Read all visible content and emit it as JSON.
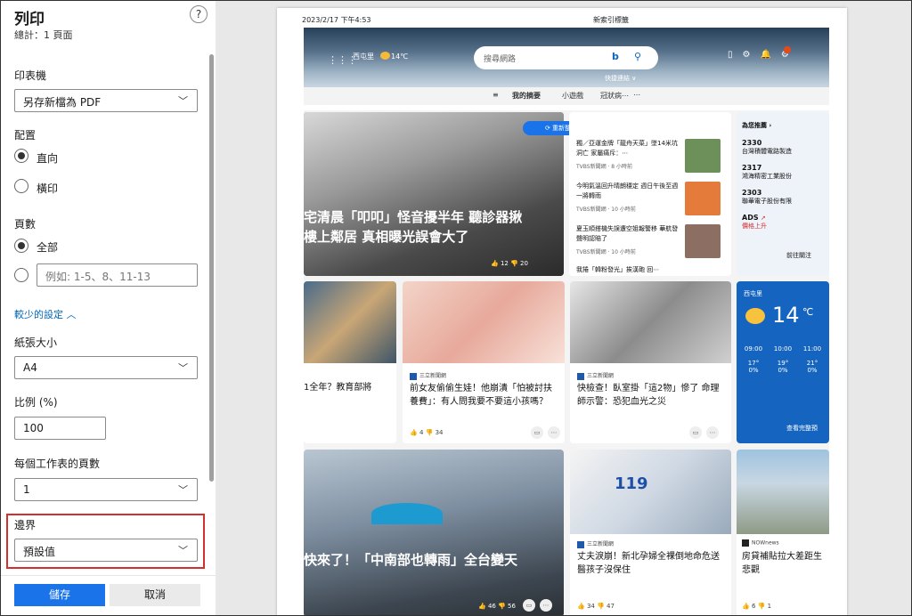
{
  "panel": {
    "title": "列印",
    "subtitle": "總計：1 頁面",
    "help": "?",
    "printer_label": "印表機",
    "printer_value": "另存新檔為 PDF",
    "layout_label": "配置",
    "layout_options": [
      "直向",
      "橫印"
    ],
    "pages_label": "頁數",
    "pages_all": "全部",
    "pages_placeholder": "例如: 1-5、8、11-13",
    "fewer_settings": "較少的設定",
    "paper_label": "紙張大小",
    "paper_value": "A4",
    "scale_label": "比例 (%)",
    "scale_value": "100",
    "pps_label": "每個工作表的頁數",
    "pps_value": "1",
    "margins_label": "邊界",
    "margins_value": "預設值",
    "save": "儲存",
    "cancel": "取消"
  },
  "preview": {
    "date": "2023/2/17 下午4:53",
    "tab_title": "新索引標籤",
    "location": "西屯里",
    "temp": "14℃",
    "search_placeholder": "搜尋網路",
    "hero_sub": "快捷連結 ∨",
    "nav": [
      "我的摘要",
      "小遊戲",
      "冠狀病⋯",
      "⋯"
    ],
    "refresh": "重新整理故事",
    "headline": [
      "宅清晨「叩叩」怪音擾半年 聽診器揪",
      "樓上鄰居 真相曝光誤會大了"
    ],
    "headline_likes": "12",
    "headline_dislikes": "20",
    "news": [
      {
        "text": "獨／亞運金牌「龍舟天菜」墜14米坑洞亡 家屬痛斥：⋯",
        "src": "TVBS新聞網 · 8 小時前"
      },
      {
        "text": "今明氣溫回升晴朗穩定 週日午後至週一將轉雨",
        "src": "TVBS新聞網 · 10 小時前"
      },
      {
        "text": "夏玉順搭機失誤遭空姐報警移 華航發聲明認賠了",
        "src": "TVBS新聞網 · 10 小時前"
      },
      {
        "text": "我捲「韓粉發光」挨漢砲 回⋯",
        "src": ""
      }
    ],
    "stocks_title": "為您推薦 ›",
    "stocks": [
      {
        "code": "2330",
        "name": "台灣積體電路製造",
        "up": false
      },
      {
        "code": "2317",
        "name": "鴻海精密工業股份",
        "up": false
      },
      {
        "code": "2303",
        "name": "聯華電子股份有限",
        "up": false
      },
      {
        "code": "ADS",
        "name": "價格上升",
        "up": true
      }
    ],
    "stocks_more": "前往關注",
    "card1_text": "1全年？教育部將",
    "card2_src": "三立新聞網",
    "card2_text": "前女友偷偷生娃！他崩潰「怕被討扶養費」：有人問我要不要這小孩嗎？",
    "card2_likes": "4",
    "card2_dislikes": "34",
    "card3_src": "三立新聞網",
    "card3_text": "快檢查！臥室掛「這2物」慘了 命理師示警：恐犯血光之災",
    "weather_loc": "西屯里",
    "weather_temp": "14",
    "weather_unit": "℃",
    "weather_hours": [
      {
        "t": "09:00",
        "v": "17°",
        "p": "0%"
      },
      {
        "t": "10:00",
        "v": "19°",
        "p": "0%"
      },
      {
        "t": "11:00",
        "v": "21°",
        "p": "0%"
      }
    ],
    "weather_more": "查看完整預",
    "card5_text": "快來了！「中南部也轉雨」全台變天",
    "card5_likes": "46",
    "card5_dislikes": "56",
    "card6_src": "三立新聞網",
    "card6_text": "丈夫淚崩！新北孕婦全裸倒地命危送醫孩子沒保住",
    "card6_likes": "34",
    "card6_dislikes": "47",
    "card7_src": "NOWnews",
    "card7_text": "房貸補貼拉大差距生悲觀",
    "card7_likes": "6",
    "card7_dislikes": "1",
    "ambulance": "119"
  }
}
